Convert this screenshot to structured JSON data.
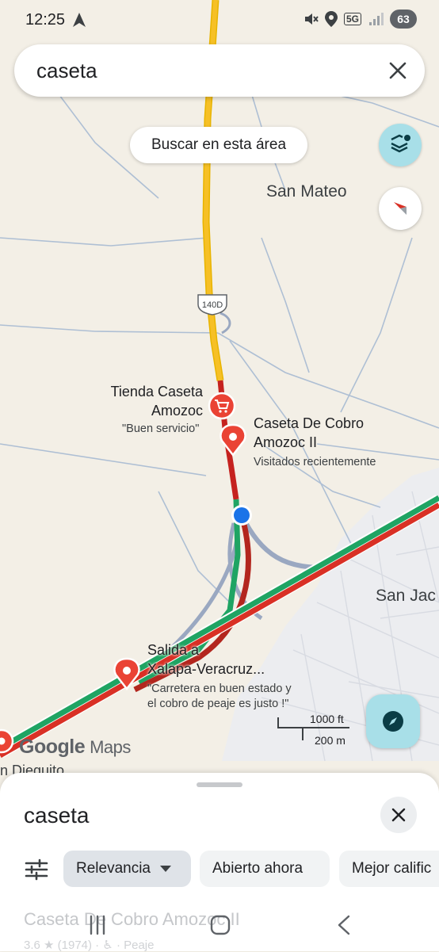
{
  "status_bar": {
    "time": "12:25",
    "network": "5G",
    "battery": "63",
    "icons": [
      "navigation-arrow-icon",
      "mute-icon",
      "location-icon",
      "signal-icon"
    ]
  },
  "search": {
    "query": "caseta"
  },
  "map": {
    "search_area_label": "Buscar en esta área",
    "places": {
      "san_mateo": "San Mateo",
      "san_jac": "San Jac",
      "dieguito": "n Dieguito"
    },
    "highway_shield": "140D",
    "pois": [
      {
        "name_lines": [
          "Tienda Caseta",
          "Amozoc"
        ],
        "subtitle": "\"Buen servicio\"",
        "icon": "shopping-cart-icon"
      },
      {
        "name_lines": [
          "Caseta De Cobro",
          "Amozoc II"
        ],
        "subtitle": "Visitados recientemente",
        "icon": "place-pin-icon"
      },
      {
        "name_lines": [
          "Salida a",
          "Xalapa-Veracruz..."
        ],
        "subtitle_lines": [
          "\"Carretera en buen estado y",
          "el cobro de peaje es justo !\""
        ],
        "icon": "place-pin-icon"
      }
    ],
    "scale": {
      "imperial": "1000 ft",
      "metric": "200 m"
    },
    "logo": {
      "google": "Google",
      "maps": "Maps"
    },
    "colors": {
      "route_red": "#c5221f",
      "route_green": "#1fa463",
      "road_yellow": "#f6c026",
      "user_dot": "#1a73e8"
    }
  },
  "sheet": {
    "title": "caseta",
    "chips": [
      "Relevancia",
      "Abierto ahora",
      "Mejor calific"
    ],
    "first_result": {
      "name": "Caseta De Cobro Amozoc II",
      "meta": "3.6 ★ (1974) · ♿ · Peaje"
    }
  }
}
